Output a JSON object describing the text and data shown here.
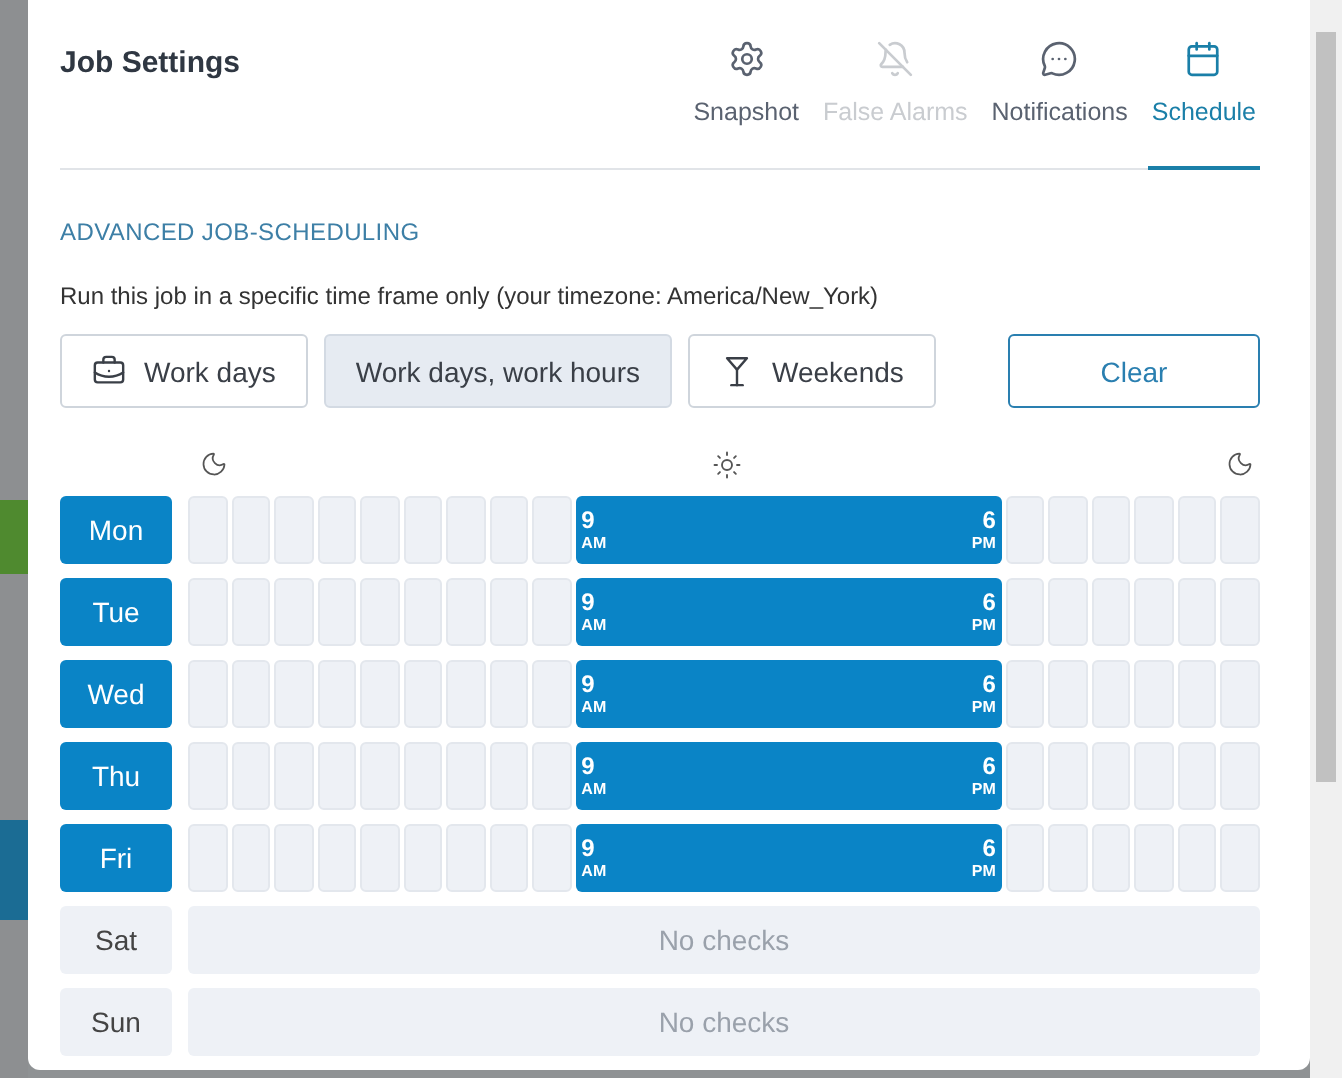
{
  "dialog": {
    "title": "Job Settings"
  },
  "tabs": [
    {
      "label": "Snapshot",
      "kind": "gear",
      "selected": false,
      "disabled": false
    },
    {
      "label": "False Alarms",
      "kind": "bell-off",
      "selected": false,
      "disabled": true
    },
    {
      "label": "Notifications",
      "kind": "chat",
      "selected": false,
      "disabled": false
    },
    {
      "label": "Schedule",
      "kind": "calendar",
      "selected": true,
      "disabled": false
    }
  ],
  "section_heading": "ADVANCED JOB-SCHEDULING",
  "description": "Run this job in a specific time frame only (your timezone: America/New_York)",
  "presets": [
    {
      "label": "Work days",
      "kind": "briefcase",
      "selected": false
    },
    {
      "label": "Work days, work hours",
      "selected": true
    },
    {
      "label": "Weekends",
      "kind": "glass",
      "selected": false
    }
  ],
  "clear_button": "Clear",
  "days": [
    {
      "label": "Mon",
      "selected": true,
      "start": {
        "hour": "9",
        "period": "AM"
      },
      "end": {
        "hour": "6",
        "period": "PM"
      },
      "slots": [
        {
          "on": false
        },
        {
          "on": false
        },
        {
          "on": false
        },
        {
          "on": false
        },
        {
          "on": false
        },
        {
          "on": false
        },
        {
          "on": false
        },
        {
          "on": false
        },
        {
          "on": false
        },
        {
          "on": true
        },
        {
          "on": true
        },
        {
          "on": true
        },
        {
          "on": true
        },
        {
          "on": true
        },
        {
          "on": true
        },
        {
          "on": true
        },
        {
          "on": true
        },
        {
          "on": true
        },
        {
          "on": true
        },
        {
          "on": false
        },
        {
          "on": false
        },
        {
          "on": false
        },
        {
          "on": false
        },
        {
          "on": false
        },
        {
          "on": false
        }
      ]
    },
    {
      "label": "Tue",
      "selected": true,
      "start": {
        "hour": "9",
        "period": "AM"
      },
      "end": {
        "hour": "6",
        "period": "PM"
      },
      "slots": [
        {
          "on": false
        },
        {
          "on": false
        },
        {
          "on": false
        },
        {
          "on": false
        },
        {
          "on": false
        },
        {
          "on": false
        },
        {
          "on": false
        },
        {
          "on": false
        },
        {
          "on": false
        },
        {
          "on": true
        },
        {
          "on": true
        },
        {
          "on": true
        },
        {
          "on": true
        },
        {
          "on": true
        },
        {
          "on": true
        },
        {
          "on": true
        },
        {
          "on": true
        },
        {
          "on": true
        },
        {
          "on": true
        },
        {
          "on": false
        },
        {
          "on": false
        },
        {
          "on": false
        },
        {
          "on": false
        },
        {
          "on": false
        },
        {
          "on": false
        }
      ]
    },
    {
      "label": "Wed",
      "selected": true,
      "start": {
        "hour": "9",
        "period": "AM"
      },
      "end": {
        "hour": "6",
        "period": "PM"
      },
      "slots": [
        {
          "on": false
        },
        {
          "on": false
        },
        {
          "on": false
        },
        {
          "on": false
        },
        {
          "on": false
        },
        {
          "on": false
        },
        {
          "on": false
        },
        {
          "on": false
        },
        {
          "on": false
        },
        {
          "on": true
        },
        {
          "on": true
        },
        {
          "on": true
        },
        {
          "on": true
        },
        {
          "on": true
        },
        {
          "on": true
        },
        {
          "on": true
        },
        {
          "on": true
        },
        {
          "on": true
        },
        {
          "on": true
        },
        {
          "on": false
        },
        {
          "on": false
        },
        {
          "on": false
        },
        {
          "on": false
        },
        {
          "on": false
        },
        {
          "on": false
        }
      ]
    },
    {
      "label": "Thu",
      "selected": true,
      "start": {
        "hour": "9",
        "period": "AM"
      },
      "end": {
        "hour": "6",
        "period": "PM"
      },
      "slots": [
        {
          "on": false
        },
        {
          "on": false
        },
        {
          "on": false
        },
        {
          "on": false
        },
        {
          "on": false
        },
        {
          "on": false
        },
        {
          "on": false
        },
        {
          "on": false
        },
        {
          "on": false
        },
        {
          "on": true
        },
        {
          "on": true
        },
        {
          "on": true
        },
        {
          "on": true
        },
        {
          "on": true
        },
        {
          "on": true
        },
        {
          "on": true
        },
        {
          "on": true
        },
        {
          "on": true
        },
        {
          "on": true
        },
        {
          "on": false
        },
        {
          "on": false
        },
        {
          "on": false
        },
        {
          "on": false
        },
        {
          "on": false
        },
        {
          "on": false
        }
      ]
    },
    {
      "label": "Fri",
      "selected": true,
      "start": {
        "hour": "9",
        "period": "AM"
      },
      "end": {
        "hour": "6",
        "period": "PM"
      },
      "slots": [
        {
          "on": false
        },
        {
          "on": false
        },
        {
          "on": false
        },
        {
          "on": false
        },
        {
          "on": false
        },
        {
          "on": false
        },
        {
          "on": false
        },
        {
          "on": false
        },
        {
          "on": false
        },
        {
          "on": true
        },
        {
          "on": true
        },
        {
          "on": true
        },
        {
          "on": true
        },
        {
          "on": true
        },
        {
          "on": true
        },
        {
          "on": true
        },
        {
          "on": true
        },
        {
          "on": true
        },
        {
          "on": true
        },
        {
          "on": false
        },
        {
          "on": false
        },
        {
          "on": false
        },
        {
          "on": false
        },
        {
          "on": false
        },
        {
          "on": false
        }
      ]
    },
    {
      "label": "Sat",
      "selected": false,
      "empty_text": "No checks"
    },
    {
      "label": "Sun",
      "selected": false,
      "empty_text": "No checks"
    }
  ]
}
